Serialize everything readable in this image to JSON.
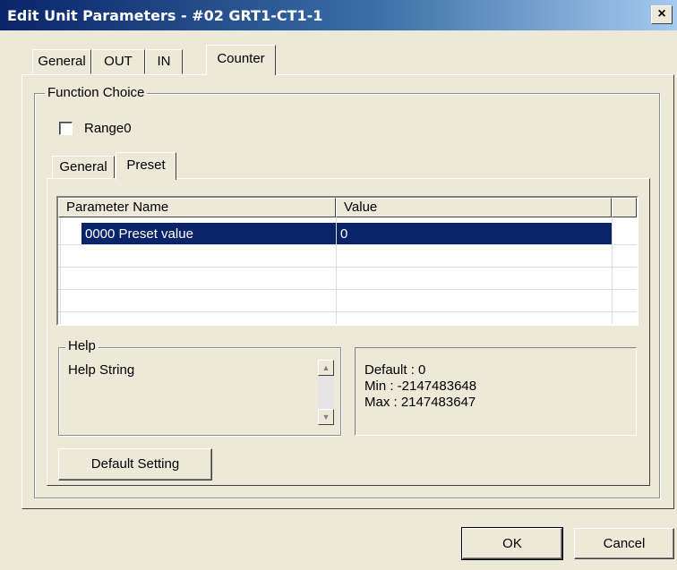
{
  "window": {
    "title": "Edit Unit Parameters - #02 GRT1-CT1-1",
    "close_glyph": "×"
  },
  "tabs": [
    {
      "label": "General"
    },
    {
      "label": "OUT"
    },
    {
      "label": "IN"
    },
    {
      "label": "Counter",
      "active": true
    }
  ],
  "function_choice": {
    "label": "Function Choice",
    "checkbox": {
      "label": "Range0",
      "checked": false
    }
  },
  "subtabs": [
    {
      "label": "General"
    },
    {
      "label": "Preset",
      "active": true
    }
  ],
  "table": {
    "columns": [
      "Parameter Name",
      "Value"
    ],
    "rows": [
      {
        "name": "0000 Preset value",
        "value": "0",
        "selected": true
      }
    ]
  },
  "help": {
    "label": "Help",
    "text": "Help String",
    "default": "Default : 0",
    "min": "Min : -2147483648",
    "max": "Max : 2147483647"
  },
  "buttons": {
    "default_setting": "Default Setting",
    "ok": "OK",
    "cancel": "Cancel"
  },
  "colors": {
    "selection": "#0a246a",
    "face": "#ece9d8",
    "titlebar": "#0a246a"
  }
}
